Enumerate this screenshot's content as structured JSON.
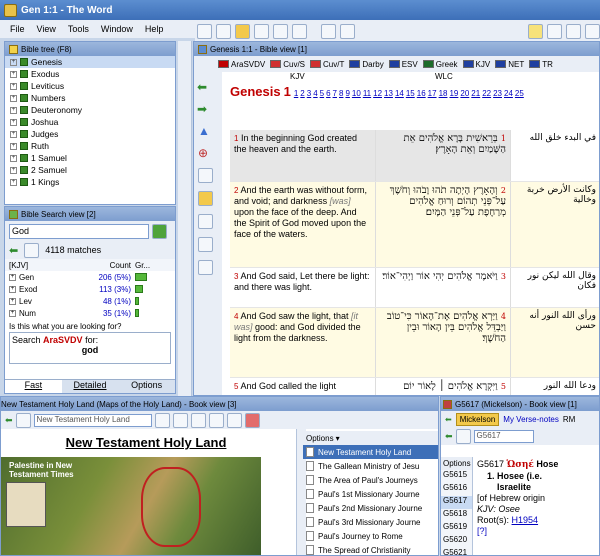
{
  "window_title": "Gen 1:1 - The Word",
  "menu": [
    "File",
    "View",
    "Tools",
    "Window",
    "Help"
  ],
  "bible_tree": {
    "title": "Bible tree (F8)",
    "books": [
      "Genesis",
      "Exodus",
      "Leviticus",
      "Numbers",
      "Deuteronomy",
      "Joshua",
      "Judges",
      "Ruth",
      "1 Samuel",
      "2 Samuel",
      "1 Kings"
    ]
  },
  "search": {
    "title": "Bible Search view [2]",
    "query": "God",
    "matches": "4118 matches",
    "version": "[KJV]",
    "count_header": "Count",
    "graph_header": "Gr...",
    "rows": [
      {
        "book": "Gen",
        "count": "206 (5%)"
      },
      {
        "book": "Exod",
        "count": "113 (3%)"
      },
      {
        "book": "Lev",
        "count": "48 (1%)"
      },
      {
        "book": "Num",
        "count": "35 (1%)"
      }
    ],
    "prompt": "Is this what you are looking for?",
    "suggest_prefix": "Search",
    "suggest_version": "AraSVDV",
    "suggest_for": "for:",
    "suggest_word": "god",
    "tabs": [
      "Fast",
      "Detailed",
      "Options"
    ]
  },
  "bible_view": {
    "title": "Genesis 1:1 - Bible view [1]",
    "versions": [
      "AraSVDV",
      "Cuv/S",
      "Cuv/T",
      "Darby",
      "ESV",
      "Greek",
      "KJV",
      "NET",
      "TR"
    ],
    "col_kjv": "KJV",
    "col_wlc": "WLC",
    "book": "Genesis",
    "chapter": "1",
    "chapter_links": [
      "1",
      "2",
      "3",
      "4",
      "5",
      "6",
      "7",
      "8",
      "9",
      "10",
      "11",
      "12",
      "13",
      "14",
      "15",
      "16",
      "17",
      "18",
      "19",
      "20",
      "21",
      "22",
      "23",
      "24",
      "25"
    ],
    "verses": [
      {
        "n": "1",
        "kjv": "In the beginning God created the heaven and the earth.",
        "wlc": "בְּרֵאשִׁית בָּרָא אֱלֹהִים אֵת הַשָּׁמַיִם וְאֵת הָאָרֶץ׃",
        "ar": "في البدء خلق الله"
      },
      {
        "n": "2",
        "kjv_a": "And the earth was without form, and void; and darkness ",
        "kjv_i": "[was]",
        "kjv_b": " upon the face of the deep. And the Spirit of God moved upon the face of the waters.",
        "wlc": "וְהָאָרֶץ הָיְתָה תֹהוּ וָבֹהוּ וְחֹשֶׁךְ עַל־פְּנֵי תְהוֹם וְרוּחַ אֱלֹהִים מְרַחֶפֶת עַל־פְּנֵי הַמָּיִם׃",
        "ar": "وكانت الأرض خربة وخالية"
      },
      {
        "n": "3",
        "kjv": "And God said, Let there be light: and there was light.",
        "wlc": "וַיֹּאמֶר אֱלֹהִים יְהִי אוֹר וַיְהִי־אוֹר׃",
        "ar": "وقال الله ليكن نور فكان"
      },
      {
        "n": "4",
        "kjv_a": "And God saw the light, that ",
        "kjv_i": "[it was]",
        "kjv_b": " good: and God divided the light from the darkness.",
        "wlc": "וַיַּרְא אֱלֹהִים אֶת־הָאוֹר כִּי־טוֹב וַיַּבְדֵּל אֱלֹהִים בֵּין הָאוֹר וּבֵין הַחֹשֶׁךְ׃",
        "ar": "ورأى الله النور أنه حسن"
      },
      {
        "n": "5",
        "kjv": "And God called the light",
        "wlc": "וַיִּקְרָא אֱלֹהִים ׀ לָאוֹר יוֹם",
        "ar": "ودعا الله النور"
      }
    ]
  },
  "map_view": {
    "title": "New Testament Holy Land (Maps of the Holy Land) - Book view [3]",
    "dropdown": "New Testament Holy Land",
    "heading": "New Testament Holy Land",
    "map_title": "Palestine in New Testament Times",
    "options_label": "Options",
    "items": [
      "New Testament Holy Land",
      "The Gallean Ministry of Jesu",
      "The Area of Paul's Journeys",
      "Paul's 1st Missionary Journe",
      "Paul's 2nd Missionary Journe",
      "Paul's 3rd Missionary Journe",
      "Paul's Journey to Rome",
      "The Spread of Christianity"
    ]
  },
  "dict_view": {
    "title": "G5617 (Mickelson) - Book view [1]",
    "tab1": "Mickelson",
    "tab2": "My Verse-notes",
    "tab3": "RM",
    "combo": "G5617",
    "options_label": "Options",
    "list": [
      "G5615",
      "G5616",
      "G5617",
      "G5618",
      "G5619",
      "G5620",
      "G5621"
    ],
    "entry_code": "G5617",
    "entry_greek": "Ὡσηέ",
    "entry_name": "Hose",
    "def1": "1. Hosee (i.e.",
    "def2": "Israelite",
    "origin": "[of Hebrew origin",
    "kjv_label": "KJV: Osee",
    "root_label": "Root(s):",
    "root_link": "H1954",
    "more": "[?]"
  }
}
